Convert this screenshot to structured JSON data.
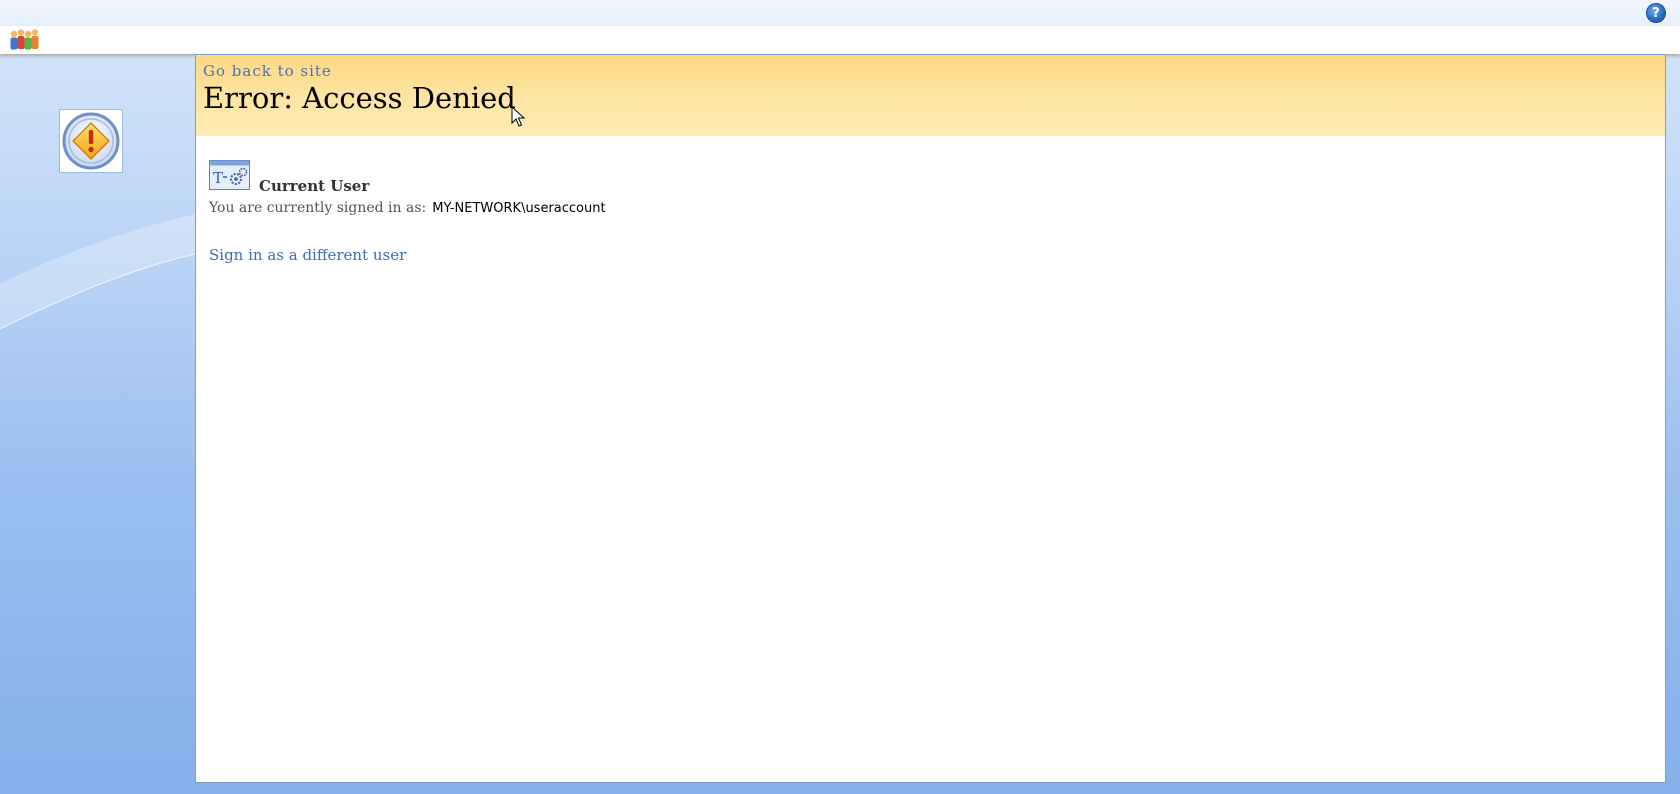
{
  "header": {
    "help_icon_glyph": "?",
    "logo_icon": "people-logo-icon"
  },
  "left_panel": {
    "badge_icon": "warning-icon"
  },
  "error": {
    "back_link": "Go back to site",
    "title": "Error: Access Denied"
  },
  "current_user": {
    "icon": "user-settings-icon",
    "heading": "Current User",
    "signed_in_label": "You are currently signed in as:",
    "account": "MY-NETWORK\\useraccount",
    "switch_link": "Sign in as a different user"
  },
  "colors": {
    "header_band": "#fde5a4",
    "link": "#3e6cbd",
    "page_background": "#9bbff0"
  }
}
